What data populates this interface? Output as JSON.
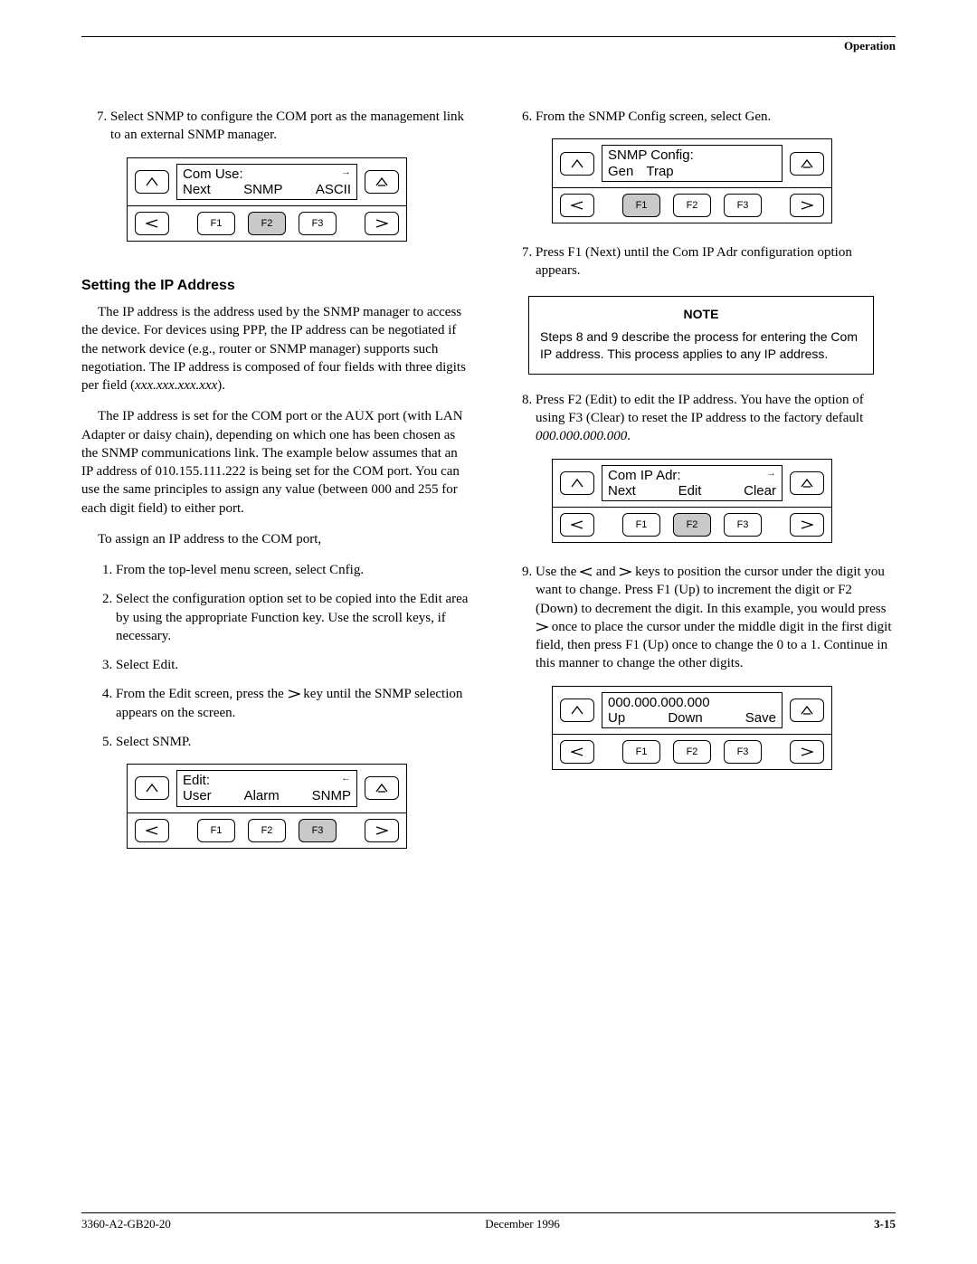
{
  "header": {
    "section": "Operation"
  },
  "footer": {
    "doc_id": "3360-A2-GB20-20",
    "date": "December 1996",
    "page": "3-15"
  },
  "left": {
    "step7": {
      "num": "7.",
      "text": "Select SNMP to configure the COM port as the management link to an external SNMP manager."
    },
    "panel_comuse": {
      "title": "Com Use:",
      "opts": [
        "Next",
        "SNMP",
        "ASCII"
      ],
      "fkeys": [
        "F1",
        "F2",
        "F3"
      ],
      "highlight": 1
    },
    "heading": "Setting the IP Address",
    "para1": "The IP address is the address used by the SNMP manager to access the device. For devices using PPP, the IP address can be negotiated if the network device (e.g., router or SNMP manager) supports such negotiation. The IP address is composed of four fields with three digits per field (",
    "para1_italic": "xxx.xxx.xxx.xxx",
    "para1_end": ").",
    "para2": "The IP address is set for the COM port or the AUX port (with LAN Adapter or daisy chain), depending on which one has been chosen as the SNMP communications link. The example below assumes that an IP address of 010.155.111.222 is being set for the COM port. You can use the same principles to assign any value (between 000 and 255 for each digit field) to either port.",
    "para3": "To assign an IP address to the COM port,",
    "steps": [
      "From the top-level menu screen, select Cnfig.",
      "Select the configuration option set to be copied into the Edit area by using the appropriate Function key. Use the scroll keys, if necessary.",
      "Select Edit.",
      "From the Edit screen, press the  ▷  key until the SNMP selection appears on the screen.",
      "Select SNMP."
    ],
    "panel_edit": {
      "title": "Edit:",
      "opts": [
        "User",
        "Alarm",
        "SNMP"
      ],
      "fkeys": [
        "F1",
        "F2",
        "F3"
      ],
      "highlight": 2
    }
  },
  "right": {
    "step6": {
      "num": "6.",
      "text": "From the SNMP Config screen, select Gen."
    },
    "panel_snmp": {
      "title": "SNMP Config:",
      "opts": [
        "Gen",
        "Trap"
      ],
      "fkeys": [
        "F1",
        "F2",
        "F3"
      ],
      "highlight": 0
    },
    "step7": {
      "num": "7.",
      "text": "Press F1 (Next) until the Com IP Adr configuration option appears."
    },
    "note": {
      "title": "NOTE",
      "body": "Steps 8 and 9 describe the process for entering the Com IP address. This process applies to any IP address."
    },
    "step8": {
      "num": "8.",
      "text_a": "Press F2 (Edit) to edit the IP address. You have the option of using F3 (Clear) to reset the IP address to the factory default ",
      "text_italic": "000.000.000.000",
      "text_b": "."
    },
    "panel_ipadr": {
      "title": "Com IP Adr:",
      "opts": [
        "Next",
        "Edit",
        "Clear"
      ],
      "fkeys": [
        "F1",
        "F2",
        "F3"
      ],
      "highlight": 1
    },
    "step9": {
      "num": "9.",
      "text": "Use the  ◁  and  ▷  keys to position the cursor under the digit you want to change. Press F1 (Up) to increment the digit or F2 (Down) to decrement the digit. In this example, you would press  ▷  once to place the cursor under the middle digit in the first digit field, then press F1 (Up) once to change the 0 to a 1. Continue in this manner to change the other digits."
    },
    "panel_ipedit": {
      "title": "000.000.000.000",
      "opts": [
        "Up",
        "Down",
        "Save"
      ],
      "fkeys": [
        "F1",
        "F2",
        "F3"
      ],
      "highlight": -1
    }
  }
}
